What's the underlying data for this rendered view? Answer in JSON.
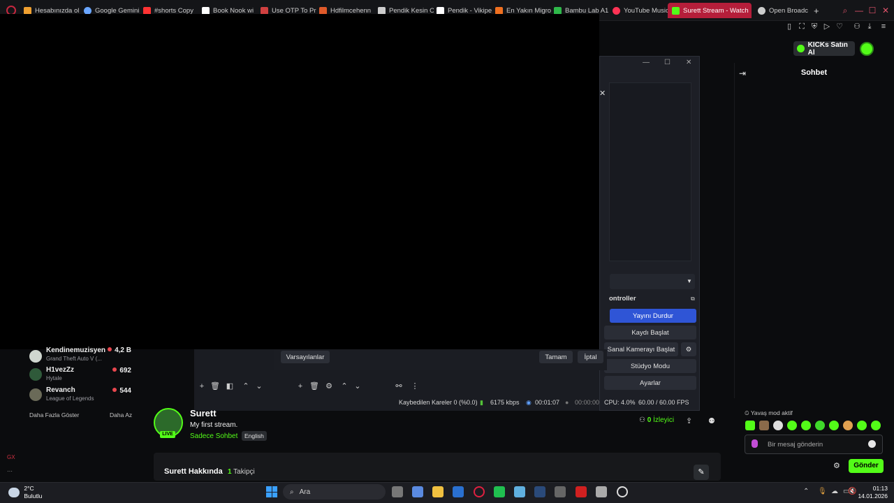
{
  "browser": {
    "tabs": [
      {
        "label": "Hesabınızda ol",
        "color": "#f0a030"
      },
      {
        "label": "Google Gemini",
        "color": "#6aa6ff"
      },
      {
        "label": "#shorts Copy",
        "color": "#ff3333"
      },
      {
        "label": "Book Nook wi",
        "color": "#ffffff"
      },
      {
        "label": "Use OTP To Pr",
        "color": "#d04040"
      },
      {
        "label": "Hdfilmcehenn",
        "color": "#e05a2a"
      },
      {
        "label": "Pendik Kesin O",
        "color": "#cccccc"
      },
      {
        "label": "Pendik - Vikipe",
        "color": "#ffffff"
      },
      {
        "label": "En Yakın Migro",
        "color": "#f07020"
      },
      {
        "label": "Bambu Lab A1",
        "color": "#2fb84a"
      },
      {
        "label": "YouTube Music",
        "color": "#ff3355"
      },
      {
        "label": "Surett Stream - Watch",
        "color": "#53fc18"
      },
      {
        "label": "Open Broadcas",
        "color": "#cccccc"
      }
    ],
    "new_tab": "+"
  },
  "kick": {
    "buy_label": "KICKs Satın Al"
  },
  "obs": {
    "controls_title": "ontroller",
    "buttons": {
      "stop_stream": "Yayını Durdur",
      "start_record": "Kaydı Başlat",
      "virtual_cam": "Sanal Kamerayı Başlat",
      "studio_mode": "Stüdyo Modu",
      "settings": "Ayarlar"
    },
    "dialog": {
      "defaults": "Varsayılanlar",
      "ok": "Tamam",
      "cancel": "İptal"
    },
    "status": {
      "dropped": "Kaybedilen Kareler 0 (%0.0)",
      "bitrate": "6175 kbps",
      "stream_time": "00:01:07",
      "rec_time": "00:00:00",
      "cpu": "CPU: 4.0%",
      "fps": "60.00 / 60.00 FPS"
    }
  },
  "channels": [
    {
      "name": "Kendinemuzisyen",
      "game": "",
      "count": "4,2 B"
    },
    {
      "name": "H1vezZz",
      "game": "Hytale",
      "count": "692"
    },
    {
      "name": "Revanch",
      "game": "League of Legends",
      "count": "544"
    },
    {
      "name": "",
      "game": "Grand Theft Auto V (...",
      "count": ""
    }
  ],
  "channels_more": "Daha Fazla Göster",
  "channels_less": "Daha Az",
  "stream": {
    "streamer": "Surett",
    "title": "My first stream.",
    "category": "Sadece Sohbet",
    "language": "English",
    "live": "LIVE",
    "viewers_count": "0",
    "viewers_label": "İzleyici"
  },
  "about": {
    "title": "Surett Hakkında",
    "followers_count": "1",
    "followers_label": "Takipçi"
  },
  "chat": {
    "title": "Sohbet",
    "slow_mode": "Yavaş mod aktif",
    "placeholder": "Bir mesaj gönderin",
    "send": "Gönder"
  },
  "taskbar": {
    "temp": "2°C",
    "weather": "Bulutlu",
    "search": "Ara",
    "time": "01:13",
    "date": "14.01.2026"
  }
}
